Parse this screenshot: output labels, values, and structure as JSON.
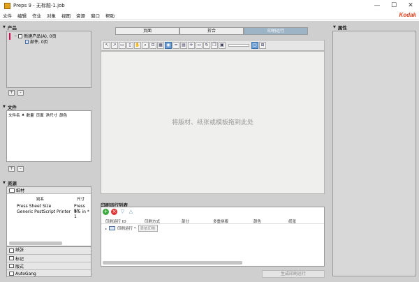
{
  "window": {
    "title": "Preps 9 - 无标题-1.job"
  },
  "menu": [
    "文件",
    "编辑",
    "作业",
    "对象",
    "视图",
    "资源",
    "窗口",
    "帮助"
  ],
  "brand": "Kodak",
  "products": {
    "header": "产品",
    "items": [
      "新建产品(A), 0页",
      "部件, 0页"
    ]
  },
  "files": {
    "header": "文件",
    "columns": [
      "文件名",
      "数量",
      "页面",
      "净尺寸",
      "颜色"
    ]
  },
  "resources": {
    "header": "资源",
    "tab_active": "纸材",
    "col_alias": "别名",
    "col_size": "尺寸",
    "rows": [
      {
        "alias": "Press Sheet Size",
        "size": "Press Sh"
      },
      {
        "alias": "Generic PostScript Printer",
        "size": "8.5 in * 1"
      }
    ],
    "tabs": [
      "纸张",
      "标记",
      "版式",
      "AutoGang"
    ]
  },
  "center_tabs": [
    "页面",
    "折合",
    "印刷运行"
  ],
  "canvas_hint": "将版材、纸张或模板拖到此处",
  "run_list": {
    "header": "印刷运行列表",
    "columns": [
      "印刷运行 ID",
      "印刷方式",
      "部分",
      "多重拼版",
      "颜色",
      "纸张"
    ],
    "row_label": "印刷运行 *",
    "row_select": "表依印刷"
  },
  "properties_header": "属性",
  "bottom_button": "生成印刷运行",
  "colors": {
    "active_tab": "#9db3c6",
    "brand": "#e53a16"
  }
}
